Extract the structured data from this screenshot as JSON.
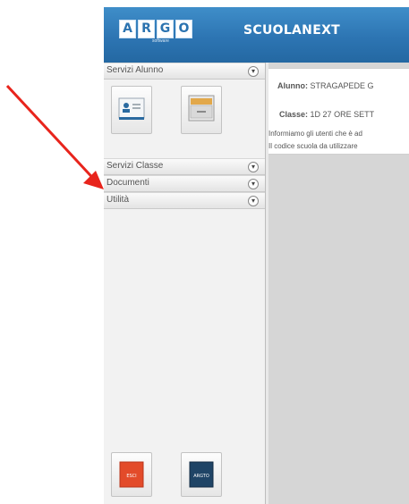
{
  "header": {
    "logo_letters": [
      "A",
      "R",
      "G",
      "O"
    ],
    "logo_sub": "software",
    "brand": "SCUOLANEXT"
  },
  "sidebar": {
    "sections": [
      {
        "label": "Servizi Alunno",
        "toggle": "▾"
      },
      {
        "label": "Servizi Classe",
        "toggle": "▾"
      },
      {
        "label": "Documenti",
        "toggle": "▾"
      },
      {
        "label": "Utilità",
        "toggle": "▾"
      }
    ],
    "bottom_buttons": [
      {
        "label": "ESCI",
        "color": "#e34b2a"
      },
      {
        "label": "ARGTO",
        "color": "#1f4466"
      }
    ]
  },
  "main": {
    "alunno_label": "Alunno:",
    "alunno_value": "STRAGAPEDE G",
    "classe_label": "Classe:",
    "classe_value": "1D 27 ORE SETT",
    "info_line1": "Informiamo gli utenti che è ad",
    "info_line2": "Il codice scuola da utilizzare"
  },
  "annotation": {
    "arrow_color": "#e8241c"
  }
}
